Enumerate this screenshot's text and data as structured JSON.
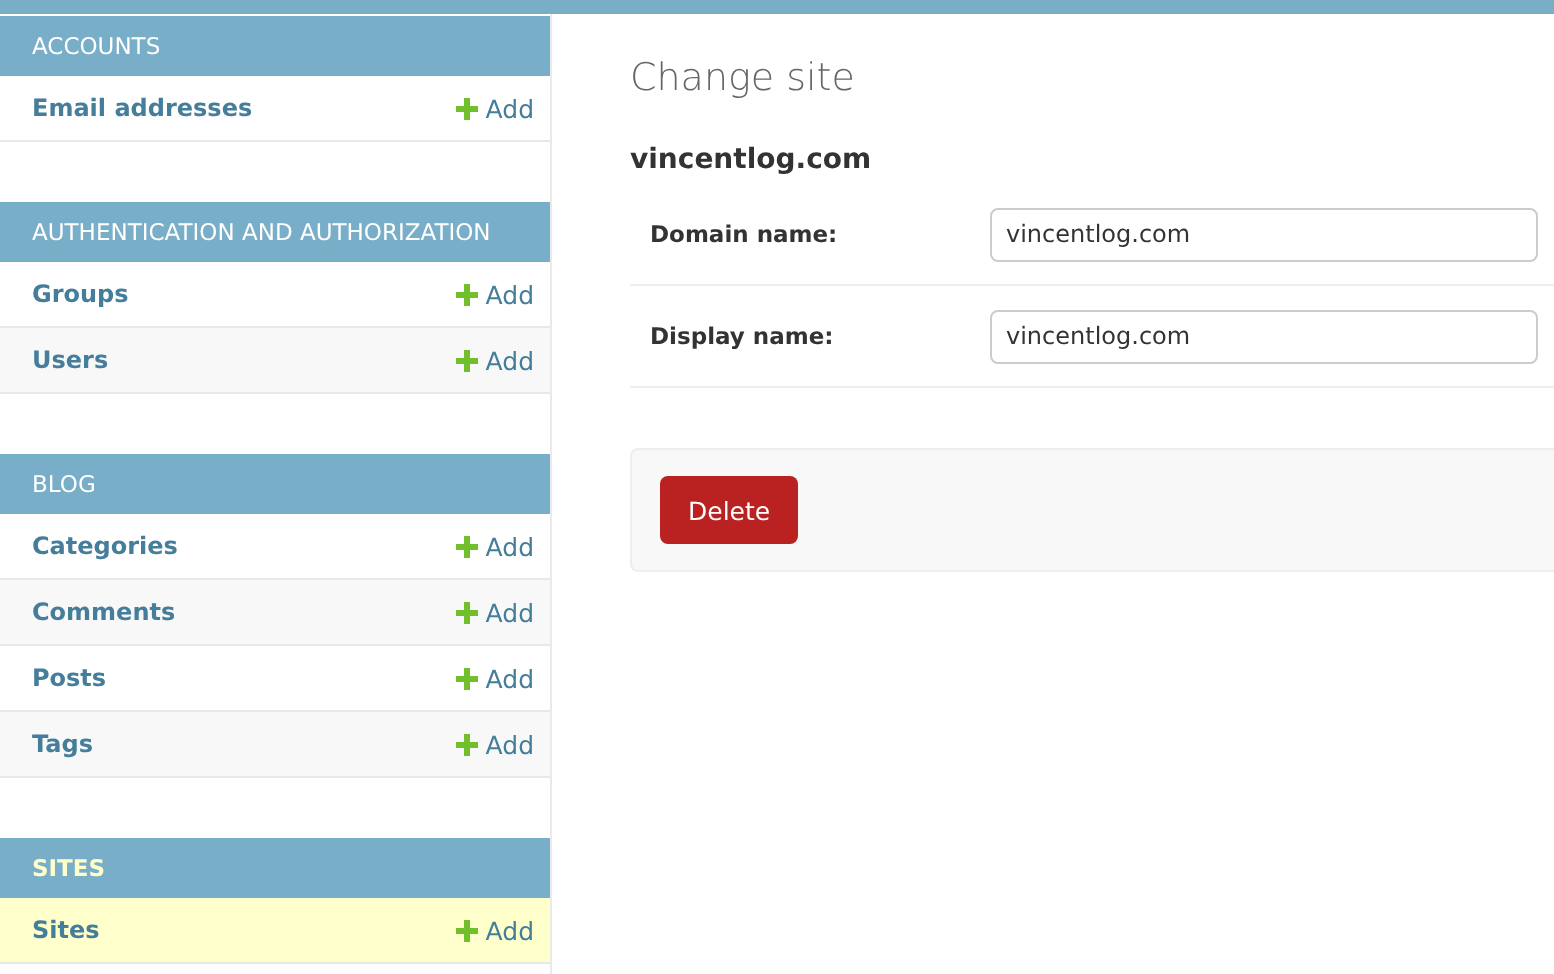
{
  "sidebar": {
    "modules": [
      {
        "caption": "ACCOUNTS",
        "selected": false,
        "items": [
          {
            "label": "Email addresses",
            "add": "Add",
            "selected": false
          }
        ]
      },
      {
        "caption": "AUTHENTICATION AND AUTHORIZATION",
        "selected": false,
        "items": [
          {
            "label": "Groups",
            "add": "Add",
            "selected": false
          },
          {
            "label": "Users",
            "add": "Add",
            "selected": false
          }
        ]
      },
      {
        "caption": "BLOG",
        "selected": false,
        "items": [
          {
            "label": "Categories",
            "add": "Add",
            "selected": false
          },
          {
            "label": "Comments",
            "add": "Add",
            "selected": false
          },
          {
            "label": "Posts",
            "add": "Add",
            "selected": false
          },
          {
            "label": "Tags",
            "add": "Add",
            "selected": false
          }
        ]
      },
      {
        "caption": "SITES",
        "selected": true,
        "items": [
          {
            "label": "Sites",
            "add": "Add",
            "selected": true
          }
        ]
      }
    ]
  },
  "content": {
    "title": "Change site",
    "object": "vincentlog.com",
    "fields": [
      {
        "label": "Domain name:",
        "value": "vincentlog.com"
      },
      {
        "label": "Display name:",
        "value": "vincentlog.com"
      }
    ],
    "delete_button": "Delete"
  }
}
